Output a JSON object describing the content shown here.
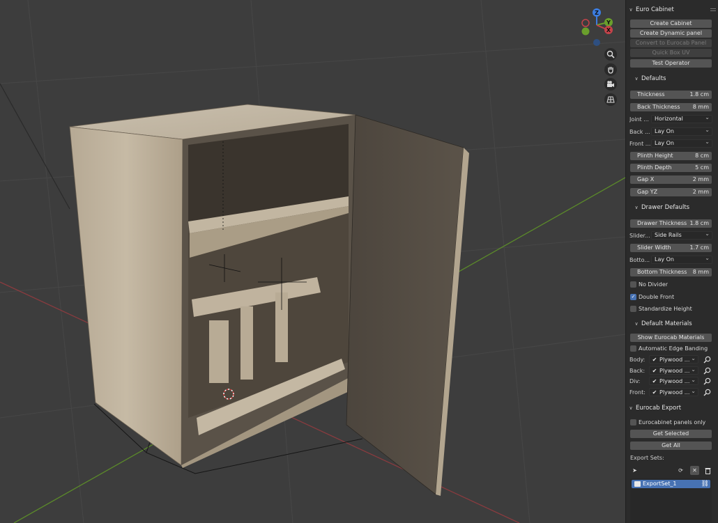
{
  "gizmo": {
    "z": "Z",
    "y": "Y",
    "x": "X"
  },
  "nav_icons": [
    "zoom-icon",
    "pan-hand-icon",
    "camera-icon",
    "grid-view-icon"
  ],
  "euro_cabinet": {
    "title": "Euro Cabinet",
    "buttons": [
      "Create Cabinet",
      "Create Dynamic panel",
      "Convert to Eurocab Panel",
      "Quick Box UV",
      "Test Operator"
    ]
  },
  "defaults": {
    "title": "Defaults",
    "thickness": {
      "label": "Thickness",
      "value": "1.8 cm"
    },
    "back_thickness": {
      "label": "Back Thickness",
      "value": "8 mm"
    },
    "joint": {
      "label": "Joint ...",
      "value": "Horizontal"
    },
    "back": {
      "label": "Back ...",
      "value": "Lay On"
    },
    "front": {
      "label": "Front ...",
      "value": "Lay On"
    },
    "plinth_height": {
      "label": "Plinth Height",
      "value": "8 cm"
    },
    "plinth_depth": {
      "label": "Plinth Depth",
      "value": "5 cm"
    },
    "gap_x": {
      "label": "Gap X",
      "value": "2 mm"
    },
    "gap_yz": {
      "label": "Gap YZ",
      "value": "2 mm"
    }
  },
  "drawer_defaults": {
    "title": "Drawer Defaults",
    "drawer_thickness": {
      "label": "Drawer Thickness",
      "value": "1.8 cm"
    },
    "slider": {
      "label": "Slider...",
      "value": "Side Rails"
    },
    "slider_width": {
      "label": "Slider Width",
      "value": "1.7 cm"
    },
    "bottom": {
      "label": "Botto...",
      "value": "Lay On"
    },
    "bottom_thickness": {
      "label": "Bottom Thickness",
      "value": "8 mm"
    },
    "no_divider": {
      "label": "No Divider",
      "checked": false
    },
    "double_front": {
      "label": "Double Front",
      "checked": true
    },
    "standardize_height": {
      "label": "Standardize Height",
      "checked": false
    }
  },
  "default_materials": {
    "title": "Default Materials",
    "show_button": "Show Eurocab Materials",
    "automatic_edge_banding": {
      "label": "Automatic Edge Banding",
      "checked": false
    },
    "rows": [
      {
        "label": "Body:",
        "value": "Plywood ..."
      },
      {
        "label": "Back:",
        "value": "Plywood ..."
      },
      {
        "label": "Div:",
        "value": "Plywood ..."
      },
      {
        "label": "Front:",
        "value": "Plywood ..."
      }
    ]
  },
  "eurocab_export": {
    "title": "Eurocab Export",
    "panels_only": {
      "label": "Eurocabinet panels only",
      "checked": false
    },
    "get_selected": "Get Selected",
    "get_all": "Get All",
    "export_sets_label": "Export Sets:",
    "export_sets": [
      "ExportSet_1"
    ]
  },
  "colors": {
    "sidebar_bg": "#2b2b2b",
    "button_bg": "#545454",
    "accent": "#4772b3",
    "viewport_bg": "#3d3d3d",
    "axis_x": "#c4434a",
    "axis_y": "#6a9f2c",
    "axis_z": "#3c7de0"
  }
}
